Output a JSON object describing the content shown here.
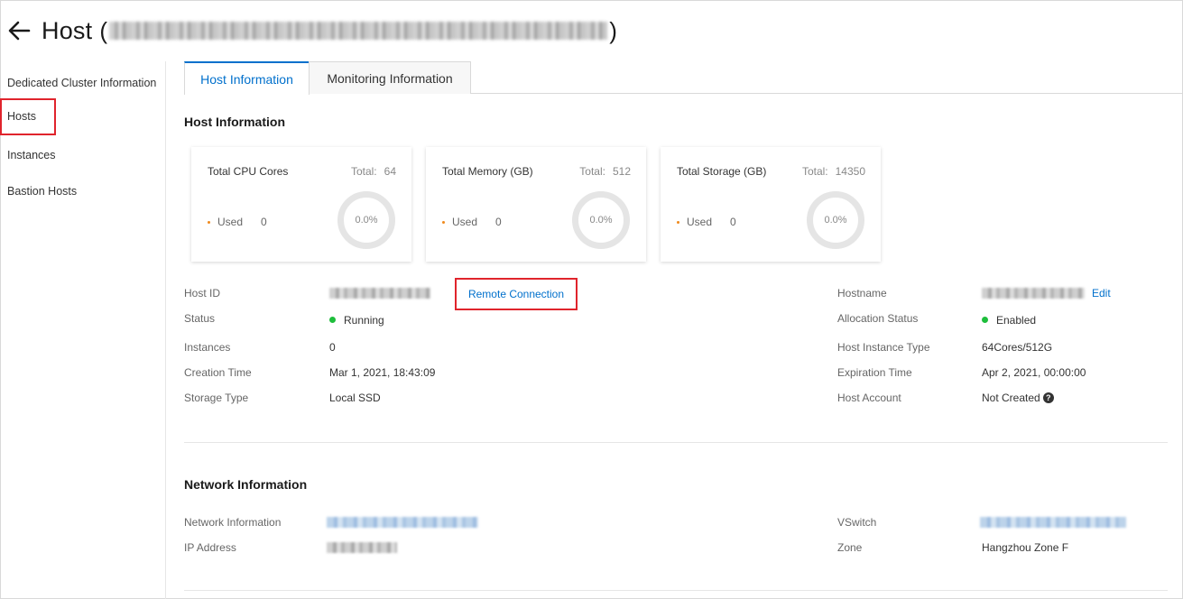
{
  "header": {
    "title": "Host",
    "paren_open": "(",
    "paren_close": ")"
  },
  "sidebar": {
    "items": [
      {
        "label": "Dedicated Cluster Information"
      },
      {
        "label": "Hosts"
      },
      {
        "label": "Instances"
      },
      {
        "label": "Bastion Hosts"
      }
    ]
  },
  "tabs": [
    {
      "label": "Host Information",
      "active": true
    },
    {
      "label": "Monitoring Information",
      "active": false
    }
  ],
  "host_info": {
    "section_title": "Host Information",
    "cards": [
      {
        "label": "Total CPU Cores",
        "total_label": "Total:",
        "total": "64",
        "used_label": "Used",
        "used": "0",
        "percent": "0.0%"
      },
      {
        "label": "Total Memory (GB)",
        "total_label": "Total:",
        "total": "512",
        "used_label": "Used",
        "used": "0",
        "percent": "0.0%"
      },
      {
        "label": "Total Storage (GB)",
        "total_label": "Total:",
        "total": "14350",
        "used_label": "Used",
        "used": "0",
        "percent": "0.0%"
      }
    ],
    "left": {
      "host_id_label": "Host ID",
      "remote_connection": "Remote Connection",
      "status_label": "Status",
      "status_value": "Running",
      "instances_label": "Instances",
      "instances_value": "0",
      "creation_time_label": "Creation Time",
      "creation_time_value": "Mar 1, 2021, 18:43:09",
      "storage_type_label": "Storage Type",
      "storage_type_value": "Local SSD"
    },
    "right": {
      "hostname_label": "Hostname",
      "edit_label": "Edit",
      "allocation_status_label": "Allocation Status",
      "allocation_status_value": "Enabled",
      "instance_type_label": "Host Instance Type",
      "instance_type_value": "64Cores/512G",
      "expiration_time_label": "Expiration Time",
      "expiration_time_value": "Apr 2, 2021, 00:00:00",
      "host_account_label": "Host Account",
      "host_account_value": "Not Created"
    }
  },
  "network": {
    "section_title": "Network Information",
    "network_info_label": "Network Information",
    "ip_address_label": "IP Address",
    "vswitch_label": "VSwitch",
    "zone_label": "Zone",
    "zone_value": "Hangzhou Zone F"
  },
  "colors": {
    "accent": "#0070cc",
    "highlight_box": "#e0242c",
    "status_green": "#1ebe3c",
    "used_dot": "#f08a1d"
  },
  "icons": {
    "back": "arrow-left-icon",
    "help": "question-circle-icon"
  }
}
